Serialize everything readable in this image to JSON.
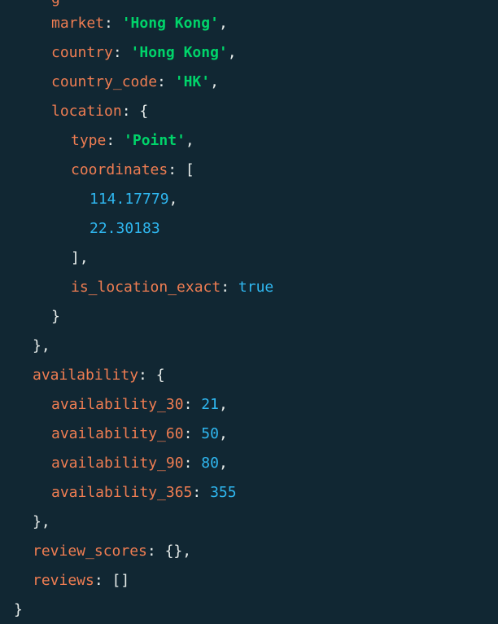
{
  "lines": {
    "l0": {
      "key": "geo_location_partial",
      "text": "g"
    },
    "market": {
      "key": "market",
      "value": "'Hong Kong'"
    },
    "country": {
      "key": "country",
      "value": "'Hong Kong'"
    },
    "country_code": {
      "key": "country_code",
      "value": "'HK'"
    },
    "location": {
      "key": "location"
    },
    "type": {
      "key": "type",
      "value": "'Point'"
    },
    "coordinates": {
      "key": "coordinates",
      "values": [
        "114.17779",
        "22.30183"
      ]
    },
    "is_location_exact": {
      "key": "is_location_exact",
      "value": "true"
    },
    "availability": {
      "key": "availability",
      "a30": {
        "key": "availability_30",
        "value": "21"
      },
      "a60": {
        "key": "availability_60",
        "value": "50"
      },
      "a90": {
        "key": "availability_90",
        "value": "80"
      },
      "a365": {
        "key": "availability_365",
        "value": "355"
      }
    },
    "review_scores": {
      "key": "review_scores",
      "value": "{}"
    },
    "reviews": {
      "key": "reviews",
      "value": "[]"
    }
  },
  "colors": {
    "background": "#112733",
    "key": "#ef7d52",
    "string": "#00d46a",
    "number": "#2fb7f0",
    "punctuation": "#e8edeb"
  }
}
